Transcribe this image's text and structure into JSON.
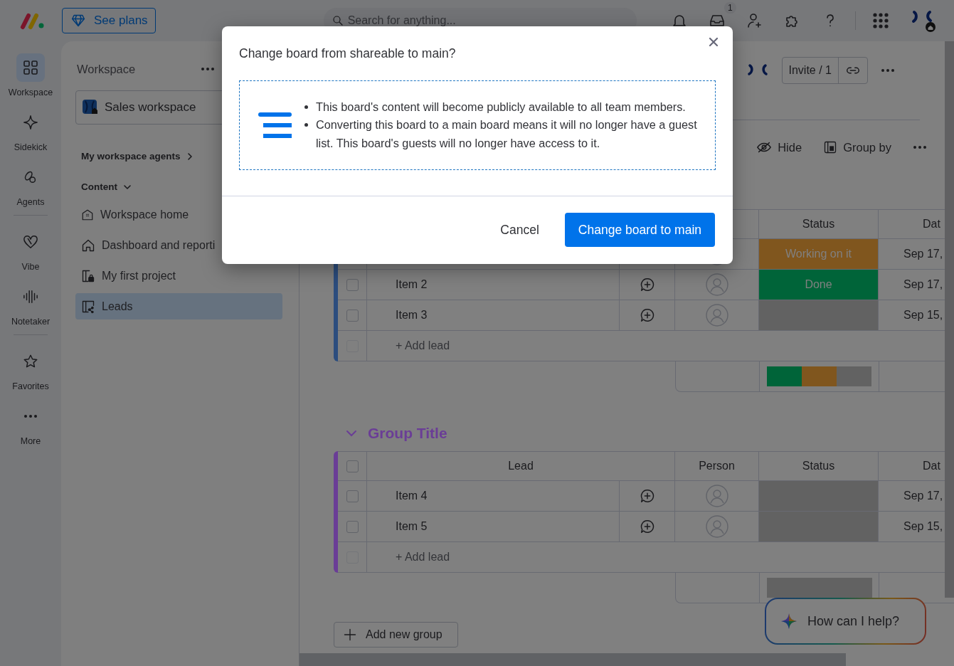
{
  "top_bar": {
    "plans_button": "See plans",
    "search": {
      "placeholder": "Search for anything..."
    },
    "inbox_badge": "1"
  },
  "rail_groups": [
    {
      "items": [
        {
          "label": "Workspace",
          "selected": true
        },
        {
          "label": "Sidekick",
          "selected": false
        },
        {
          "label": "Agents",
          "selected": false
        }
      ]
    },
    {
      "items": [
        {
          "label": "Vibe",
          "selected": false
        },
        {
          "label": "Notetaker",
          "selected": false
        }
      ]
    },
    {
      "items": [
        {
          "label": "Favorites",
          "selected": false
        },
        {
          "label": "More",
          "selected": false
        }
      ]
    }
  ],
  "nav": {
    "title": "Workspace",
    "workspace_picker": "Sales workspace",
    "agents_link": "My workspace agents",
    "section": "Content",
    "items": [
      {
        "label": "Workspace home",
        "selected": false
      },
      {
        "label": "Dashboard and reporti",
        "selected": false
      },
      {
        "label": "My first project",
        "selected": false
      },
      {
        "label": "Leads",
        "selected": true
      }
    ]
  },
  "board_header": {
    "invite_button": "Invite / 1"
  },
  "toolbar": {
    "items": [
      "Hide",
      "Group by"
    ]
  },
  "groups": [
    {
      "color": "#2c4d7e",
      "columns": {
        "status": "Status",
        "date": "Dat"
      },
      "rows": [
        {
          "status": "Working on it",
          "color": "#80561e",
          "date": "Sep 17,"
        },
        {
          "name": "Item 2",
          "checked": false,
          "status": "Done",
          "color": "#006439",
          "date": "Sep 17,"
        },
        {
          "name": "Item 3",
          "checked": false,
          "color": "#626262",
          "date": "Sep 15,"
        }
      ],
      "add_row": "+ Add lead",
      "summary": [
        {
          "color": "#006439"
        },
        {
          "color": "#80561e"
        },
        {
          "color": "#626262"
        }
      ]
    },
    {
      "title": "Group Title",
      "color": "#6a3d96",
      "select_all": false,
      "columns": {
        "lead": "Lead",
        "person": "Person",
        "status": "Status",
        "date": "Dat"
      },
      "rows": [
        {
          "name": "Item 4",
          "checked": false,
          "color": "#626262",
          "date": "Sep 17,"
        },
        {
          "name": "Item 5",
          "checked": false,
          "color": "#626262",
          "date": "Sep 15,"
        }
      ],
      "add_row": "+ Add lead",
      "summary": [
        {
          "color": "#626262"
        }
      ]
    }
  ],
  "add_group_button": "Add new group",
  "assistant": "How can I help?",
  "dialog": {
    "title": "Change board from shareable to main?",
    "bullets": [
      "This board's content will become publicly available to all team members.",
      "Converting this board to a main board means it will no longer have a guest list. This board's guests will no longer have access to it."
    ],
    "cancel": "Cancel",
    "confirm": "Change board to main"
  }
}
